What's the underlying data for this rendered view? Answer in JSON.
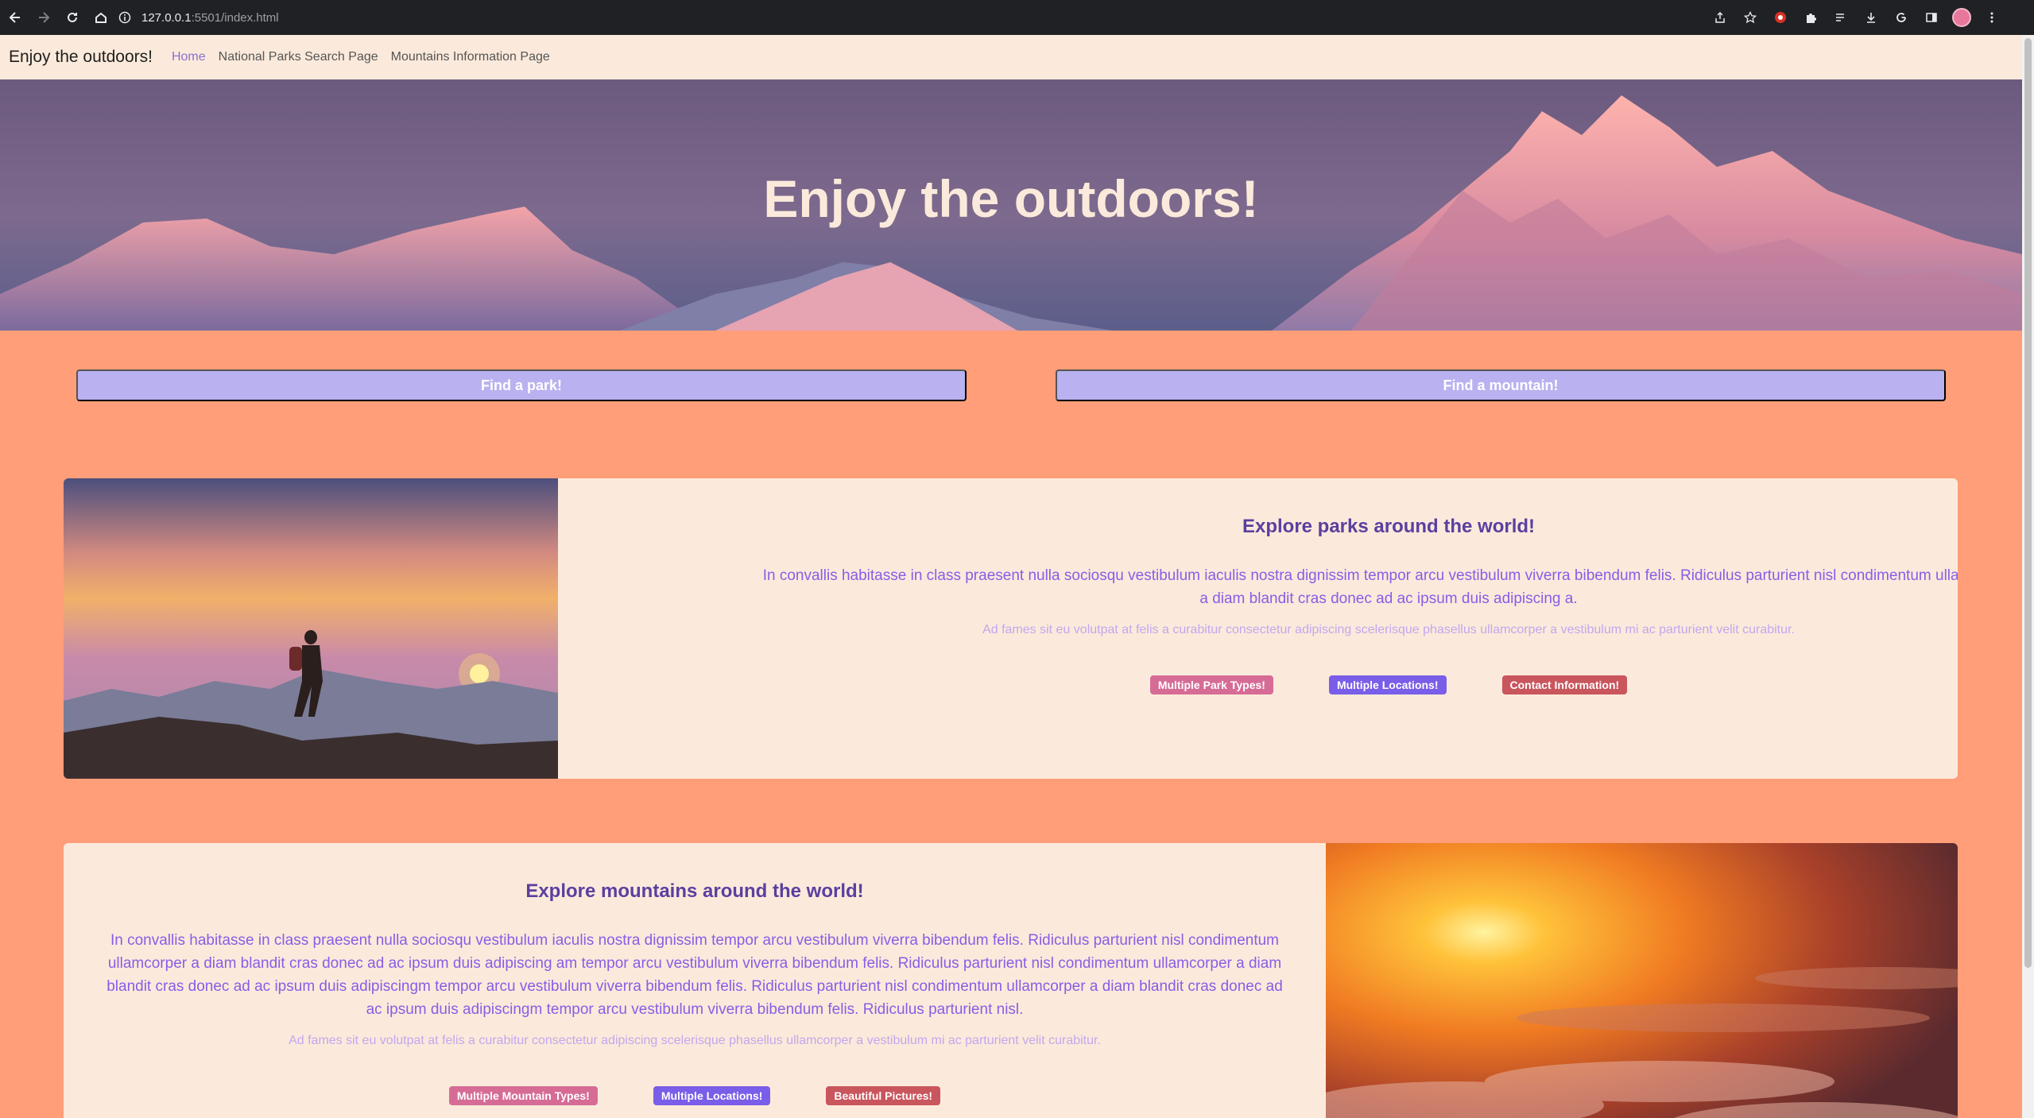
{
  "browser": {
    "url_host": "127.0.0.1",
    "url_rest": ":5501/index.html"
  },
  "navbar": {
    "brand": "Enjoy the outdoors!",
    "links": [
      "Home",
      "National Parks Search Page",
      "Mountains Information Page"
    ]
  },
  "hero": {
    "title": "Enjoy the outdoors!"
  },
  "buttons": {
    "park": "Find a park!",
    "mountain": "Find a mountain!"
  },
  "cards": [
    {
      "title": "Explore parks around the world!",
      "lead": "In convallis habitasse in class praesent nulla sociosqu vestibulum iaculis nostra dignissim tempor arcu vestibulum viverra bibendum felis. Ridiculus parturient nisl condimentum ullamcorper a diam blandit cras donec ad ac ipsum duis adipiscing a.",
      "muted": "Ad fames sit eu volutpat at felis a curabitur consectetur adipiscing scelerisque phasellus ullamcorper a vestibulum mi ac parturient velit curabitur.",
      "badges": [
        "Multiple Park Types!",
        "Multiple Locations!",
        "Contact Information!"
      ]
    },
    {
      "title": "Explore mountains around the world!",
      "lead": "In convallis habitasse in class praesent nulla sociosqu vestibulum iaculis nostra dignissim tempor arcu vestibulum viverra bibendum felis. Ridiculus parturient nisl condimentum ullamcorper a diam blandit cras donec ad ac ipsum duis adipiscing am tempor arcu vestibulum viverra bibendum felis. Ridiculus parturient nisl condimentum ullamcorper a diam blandit cras donec ad ac ipsum duis adipiscingm tempor arcu vestibulum viverra bibendum felis. Ridiculus parturient nisl condimentum ullamcorper a diam blandit cras donec ad ac ipsum duis adipiscingm tempor arcu vestibulum viverra bibendum felis. Ridiculus parturient nisl.",
      "muted": "Ad fames sit eu volutpat at felis a curabitur consectetur adipiscing scelerisque phasellus ullamcorper a vestibulum mi ac parturient velit curabitur.",
      "badges": [
        "Multiple Mountain Types!",
        "Multiple Locations!",
        "Beautiful Pictures!"
      ]
    }
  ],
  "colors": {
    "page_bg": "#ff9e78",
    "nav_bg": "#fbeadb",
    "cta_bg": "#b9b1f0",
    "heading": "#5b3fa0",
    "badge_pink": "#d66c96",
    "badge_purple": "#7a5de8",
    "badge_red": "#c9555d"
  }
}
